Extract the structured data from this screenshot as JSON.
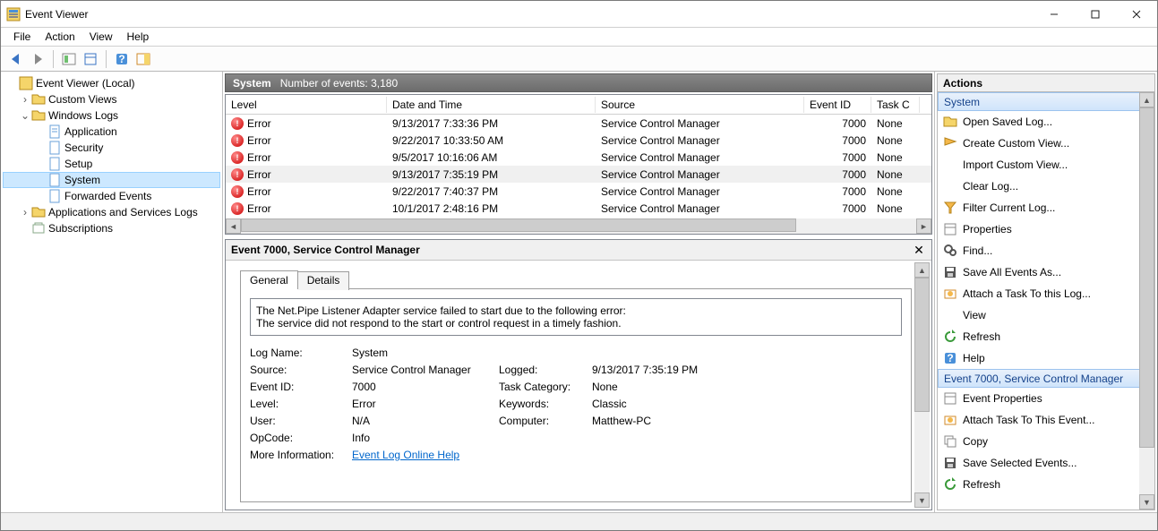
{
  "title": "Event Viewer",
  "menu": {
    "file": "File",
    "action": "Action",
    "view": "View",
    "help": "Help"
  },
  "tree": {
    "root": "Event Viewer (Local)",
    "customViews": "Custom Views",
    "winLogs": "Windows Logs",
    "app": "Application",
    "sec": "Security",
    "setup": "Setup",
    "system": "System",
    "fwd": "Forwarded Events",
    "appsvc": "Applications and Services Logs",
    "subs": "Subscriptions"
  },
  "listHeader": {
    "name": "System",
    "countLabel": "Number of events: 3,180"
  },
  "columns": {
    "level": "Level",
    "date": "Date and Time",
    "source": "Source",
    "eid": "Event ID",
    "task": "Task C"
  },
  "events": [
    {
      "level": "Error",
      "date": "9/13/2017 7:33:36 PM",
      "source": "Service Control Manager",
      "eid": "7000",
      "task": "None"
    },
    {
      "level": "Error",
      "date": "9/22/2017 10:33:50 AM",
      "source": "Service Control Manager",
      "eid": "7000",
      "task": "None"
    },
    {
      "level": "Error",
      "date": "9/5/2017 10:16:06 AM",
      "source": "Service Control Manager",
      "eid": "7000",
      "task": "None"
    },
    {
      "level": "Error",
      "date": "9/13/2017 7:35:19 PM",
      "source": "Service Control Manager",
      "eid": "7000",
      "task": "None"
    },
    {
      "level": "Error",
      "date": "9/22/2017 7:40:37 PM",
      "source": "Service Control Manager",
      "eid": "7000",
      "task": "None"
    },
    {
      "level": "Error",
      "date": "10/1/2017 2:48:16 PM",
      "source": "Service Control Manager",
      "eid": "7000",
      "task": "None"
    }
  ],
  "selectedEventIndex": 3,
  "detailHeader": "Event 7000, Service Control Manager",
  "tabs": {
    "general": "General",
    "details": "Details"
  },
  "message": {
    "line1": "The Net.Pipe Listener Adapter service failed to start due to the following error:",
    "line2": "The service did not respond to the start or control request in a timely fashion."
  },
  "propLabels": {
    "logName": "Log Name:",
    "source": "Source:",
    "eventId": "Event ID:",
    "level": "Level:",
    "user": "User:",
    "opcode": "OpCode:",
    "moreInfo": "More Information:",
    "logged": "Logged:",
    "taskCat": "Task Category:",
    "keywords": "Keywords:",
    "computer": "Computer:"
  },
  "propValues": {
    "logName": "System",
    "source": "Service Control Manager",
    "eventId": "7000",
    "level": "Error",
    "user": "N/A",
    "opcode": "Info",
    "moreInfoLink": "Event Log Online Help",
    "logged": "9/13/2017 7:35:19 PM",
    "taskCat": "None",
    "keywords": "Classic",
    "computer": "Matthew-PC"
  },
  "actions": {
    "title": "Actions",
    "groupSystem": "System",
    "itemsTop": [
      "Open Saved Log...",
      "Create Custom View...",
      "Import Custom View...",
      "Clear Log...",
      "Filter Current Log...",
      "Properties",
      "Find...",
      "Save All Events As...",
      "Attach a Task To this Log...",
      "View",
      "Refresh",
      "Help"
    ],
    "groupEvent": "Event 7000, Service Control Manager",
    "itemsBottom": [
      "Event Properties",
      "Attach Task To This Event...",
      "Copy",
      "Save Selected Events...",
      "Refresh"
    ]
  }
}
